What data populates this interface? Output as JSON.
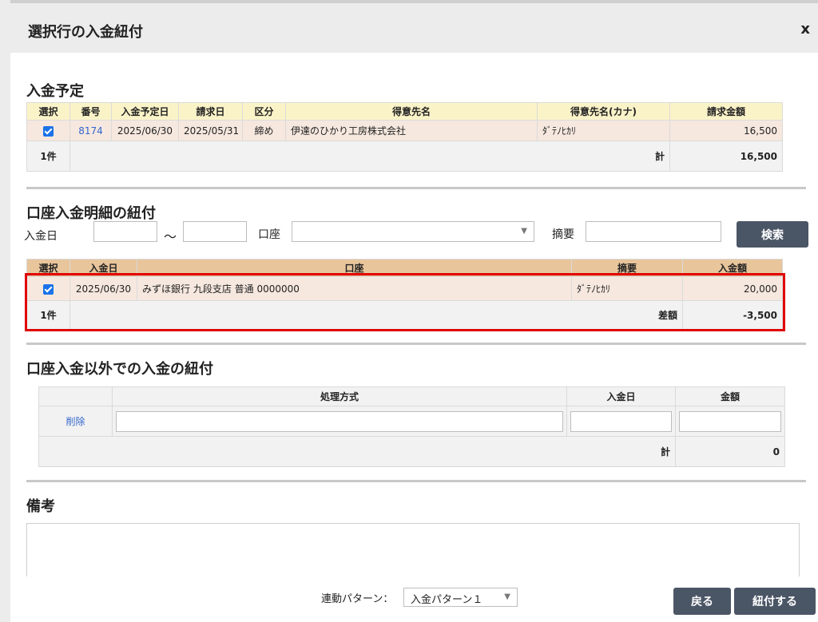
{
  "header": {
    "title": "選択行の入金紐付",
    "close_label": "x"
  },
  "schedule": {
    "title": "入金予定",
    "columns": [
      "選択",
      "番号",
      "入金予定日",
      "請求日",
      "区分",
      "得意先名",
      "得意先名(カナ)",
      "請求金額"
    ],
    "row": {
      "selected": true,
      "number": "8174",
      "due_date": "2025/06/30",
      "invoice_date": "2025/05/31",
      "category": "締め",
      "customer": "伊達のひかり工房株式会社",
      "customer_kana": "ﾀﾞﾃﾉﾋｶﾘ",
      "amount": "16,500"
    },
    "footer": {
      "count": "1件",
      "total_label": "計",
      "total": "16,500"
    }
  },
  "bank": {
    "title": "口座入金明細の紐付",
    "filters": {
      "date_label": "入金日",
      "tilde": "〜",
      "account_label": "口座",
      "memo_label": "摘要",
      "search_label": "検索"
    },
    "columns": [
      "選択",
      "入金日",
      "口座",
      "摘要",
      "入金額"
    ],
    "row": {
      "selected": true,
      "date": "2025/06/30",
      "account": "みずほ銀行 九段支店 普通 0000000",
      "memo": "ﾀﾞﾃﾉﾋｶﾘ",
      "amount": "20,000"
    },
    "footer": {
      "count": "1件",
      "diff_label": "差額",
      "diff": "-3,500"
    }
  },
  "other": {
    "title": "口座入金以外での入金の紐付",
    "columns": [
      "",
      "処理方式",
      "入金日",
      "金額"
    ],
    "delete_label": "削除",
    "footer": {
      "total_label": "計",
      "total": "0"
    }
  },
  "notes": {
    "title": "備考"
  },
  "bottom": {
    "pattern_label": "連動パターン：",
    "pattern_value": "入金パターン１",
    "back_label": "戻る",
    "link_label": "紐付する"
  },
  "colors": {
    "highlight": "#e00000",
    "button": "#4a5565",
    "link": "#3366cc"
  }
}
